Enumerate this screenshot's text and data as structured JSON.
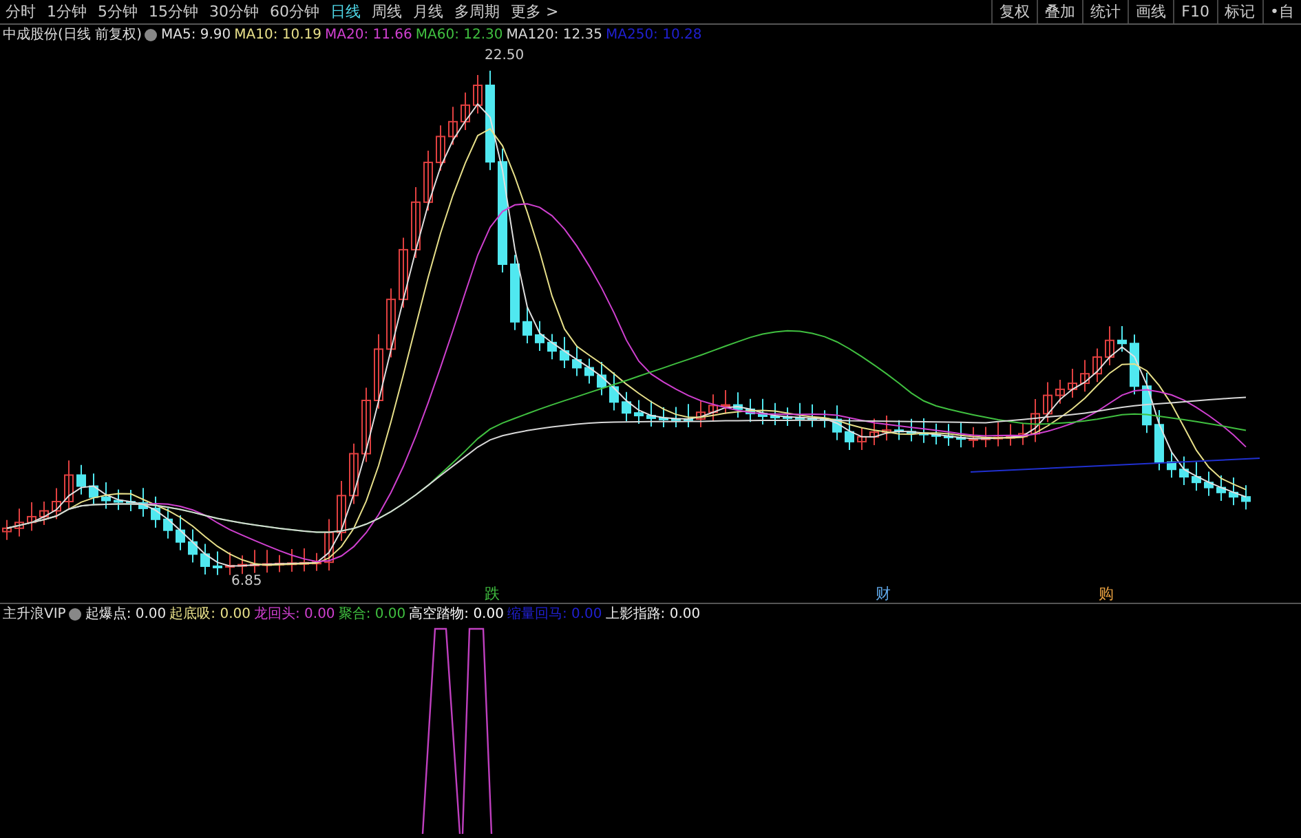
{
  "period_tabs": [
    {
      "label": "分时",
      "selected": false
    },
    {
      "label": "1分钟",
      "selected": false
    },
    {
      "label": "5分钟",
      "selected": false
    },
    {
      "label": "15分钟",
      "selected": false
    },
    {
      "label": "30分钟",
      "selected": false
    },
    {
      "label": "60分钟",
      "selected": false
    },
    {
      "label": "日线",
      "selected": true
    },
    {
      "label": "周线",
      "selected": false
    },
    {
      "label": "月线",
      "selected": false
    },
    {
      "label": "多周期",
      "selected": false
    },
    {
      "label": "更多 >",
      "selected": false
    }
  ],
  "tool_buttons": [
    "复权",
    "叠加",
    "统计",
    "画线",
    "F10",
    "标记",
    "•自"
  ],
  "main_chart": {
    "title": "中成股份(日线 前复权)",
    "ma_legend": [
      {
        "label": "MA5: 9.90",
        "color": "#e0e0e0"
      },
      {
        "label": "MA10: 10.19",
        "color": "#e8e08a"
      },
      {
        "label": "MA20: 11.66",
        "color": "#d040d0"
      },
      {
        "label": "MA60: 12.30",
        "color": "#40c040"
      },
      {
        "label": "MA120: 12.35",
        "color": "#d8d8d8"
      },
      {
        "label": "MA250: 10.28",
        "color": "#2020d0"
      }
    ],
    "high_label": "22.50",
    "low_label": "6.85",
    "signals": [
      {
        "label": "跌",
        "color": "#40c040"
      },
      {
        "label": "财",
        "color": "#60a8e8"
      },
      {
        "label": "购",
        "color": "#e8a040"
      }
    ]
  },
  "indicator": {
    "title": "主升浪VIP",
    "legend": [
      {
        "label": "起爆点: 0.00",
        "color": "#e8e8e8"
      },
      {
        "label": "起底吸: 0.00",
        "color": "#e8e08a"
      },
      {
        "label": "龙回头: 0.00",
        "color": "#d040d0"
      },
      {
        "label": "聚合: 0.00",
        "color": "#40c040"
      },
      {
        "label": "高空踏物: 0.00",
        "color": "#ffffff"
      },
      {
        "label": "缩量回马: 0.00",
        "color": "#2020d0"
      },
      {
        "label": "上影指路: 0.00",
        "color": "#f0f0f0"
      }
    ]
  }
}
